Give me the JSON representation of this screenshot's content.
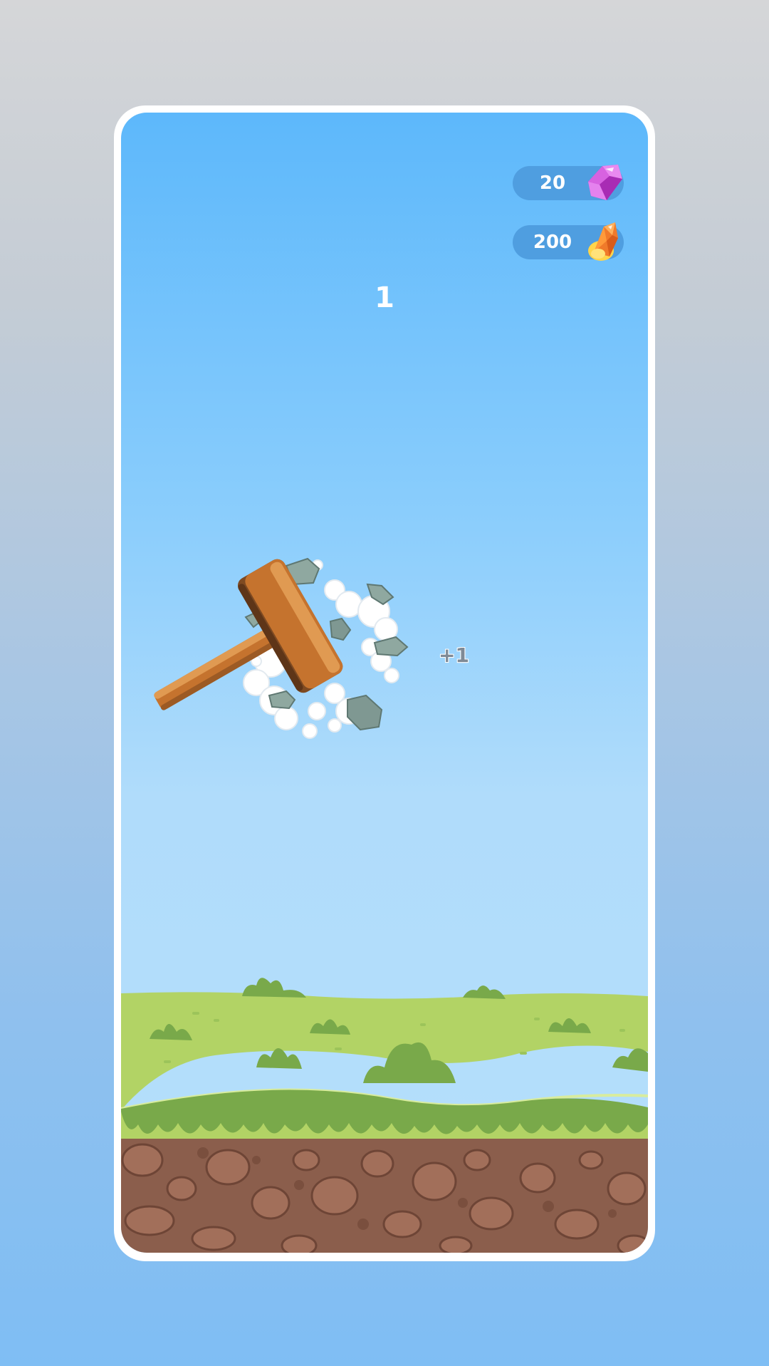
{
  "hud": {
    "gems": "20",
    "coins": "200",
    "gem_icon": "pink-crystal-icon",
    "coin_icon": "orange-crystal-icon"
  },
  "game": {
    "score": "1",
    "hit_feedback": "+1",
    "hammer": "wooden-hammer",
    "effect": "rock-smash-dust"
  },
  "colors": {
    "sky_top": "#5db8fb",
    "sky_bottom": "#b5dffb",
    "pill": "#4f9ee0",
    "grass": "#b2d365",
    "dirt": "#8b5e4c"
  }
}
